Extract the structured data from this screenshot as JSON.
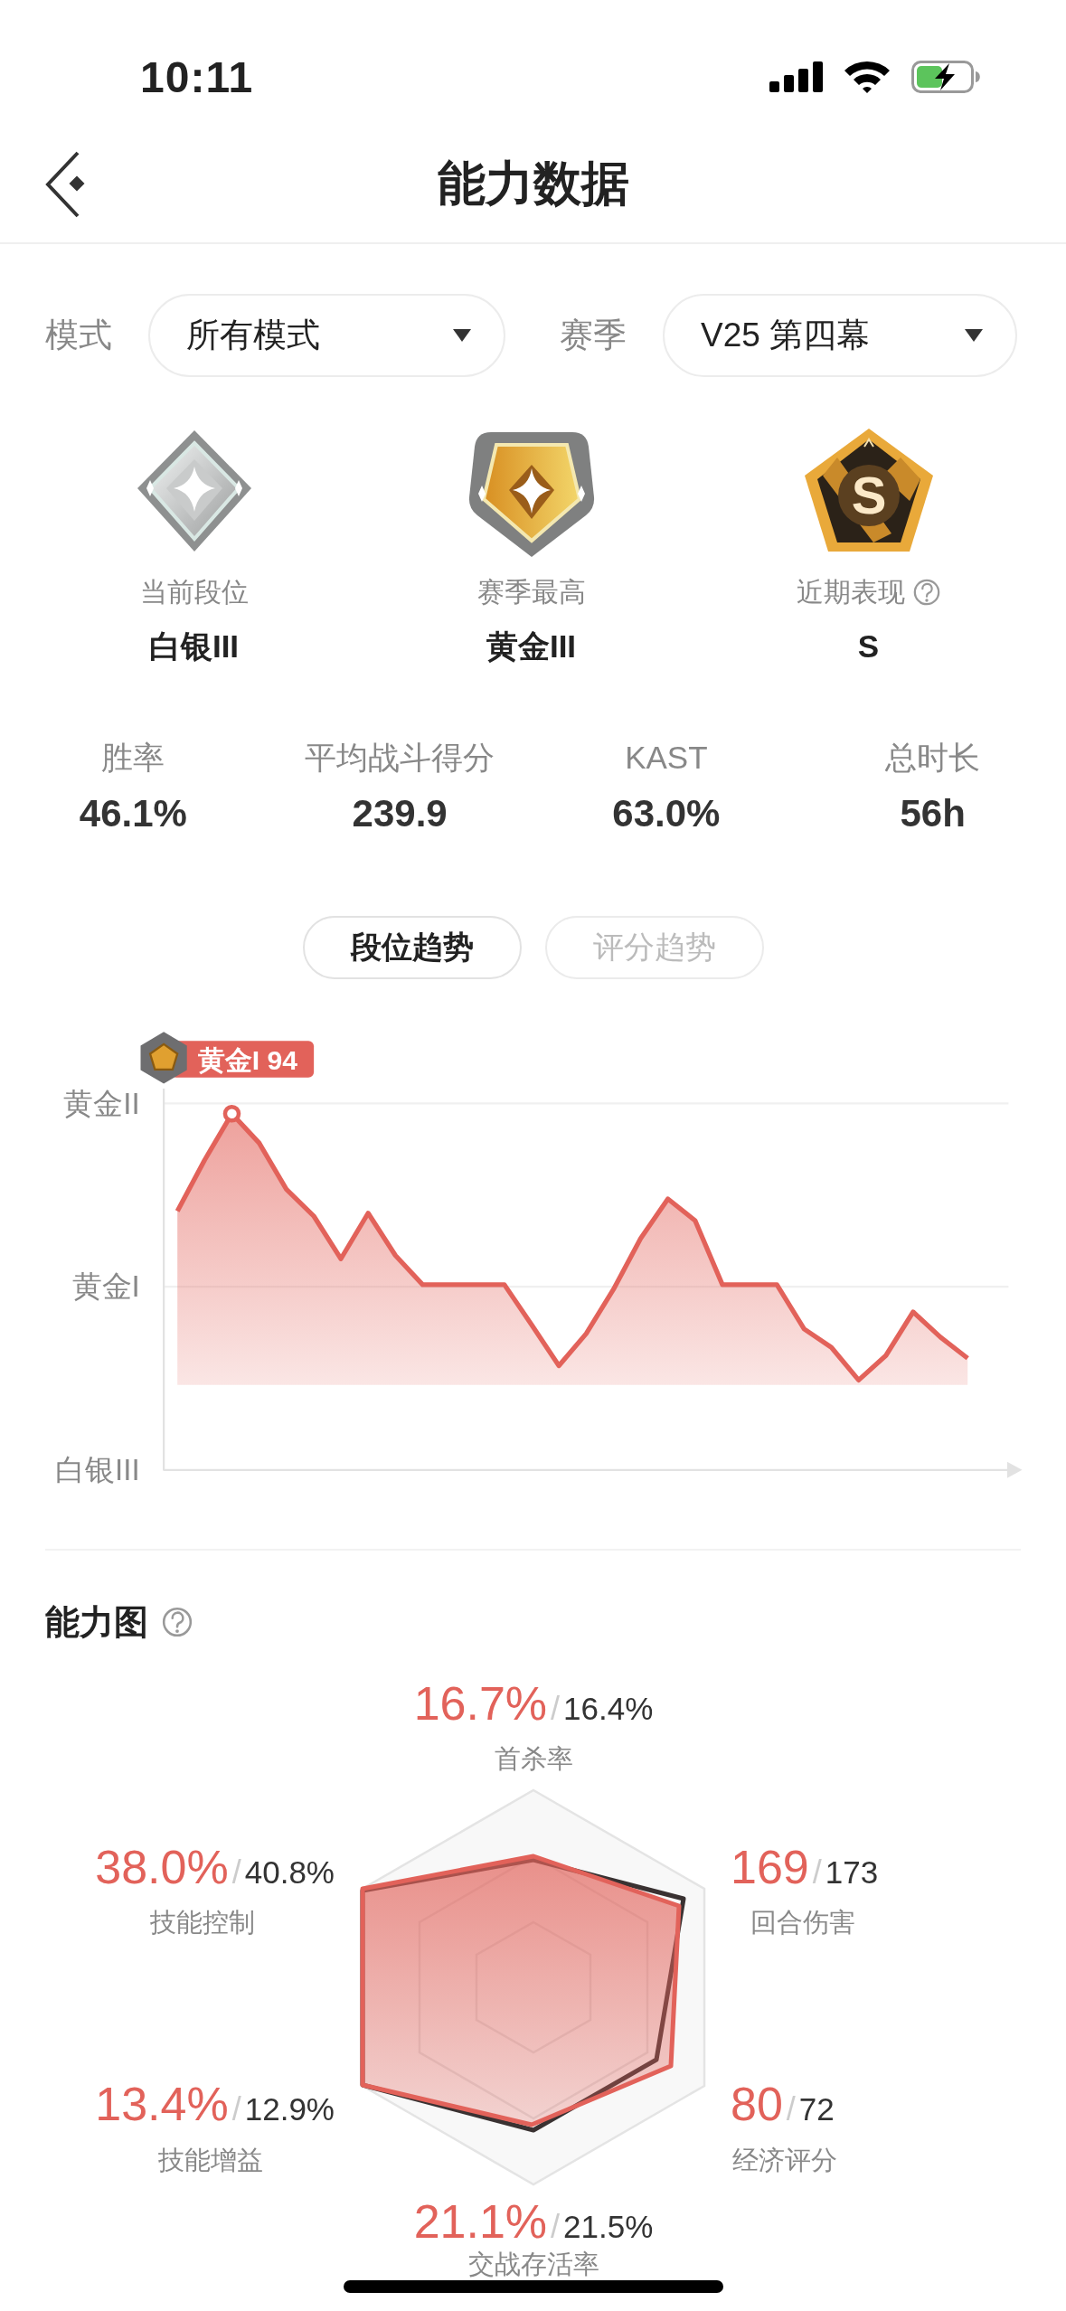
{
  "status_bar": {
    "time": "10:11"
  },
  "nav": {
    "title": "能力数据"
  },
  "filters": [
    {
      "label": "模式",
      "value": "所有模式"
    },
    {
      "label": "赛季",
      "value": "V25 第四幕"
    }
  ],
  "ranks": [
    {
      "kind": "silver",
      "caption": "当前段位",
      "value": "白银III"
    },
    {
      "kind": "gold",
      "caption": "赛季最高",
      "value": "黄金III"
    },
    {
      "kind": "grade",
      "caption": "近期表现",
      "value": "S",
      "help": true,
      "emblem_letter": "S"
    }
  ],
  "stats": [
    {
      "label": "胜率",
      "value": "46.1%"
    },
    {
      "label": "平均战斗得分",
      "value": "239.9"
    },
    {
      "label": "KAST",
      "value": "63.0%"
    },
    {
      "label": "总时长",
      "value": "56h"
    }
  ],
  "trend_tabs": [
    {
      "label": "段位趋势",
      "selected": true
    },
    {
      "label": "评分趋势",
      "selected": false
    }
  ],
  "trend_chart": {
    "y_labels": [
      "黄金II",
      "黄金I",
      "白银III"
    ],
    "peak_label": "黄金I 94"
  },
  "ability": {
    "title": "能力图",
    "help": true,
    "metrics": [
      {
        "value": "16.7%",
        "separator": "/",
        "average": "16.4%",
        "label": "首杀率"
      },
      {
        "value": "38.0%",
        "separator": "/",
        "average": "40.8%",
        "label": "技能控制"
      },
      {
        "value": "169",
        "separator": "/",
        "average": "173",
        "label": "回合伤害"
      },
      {
        "value": "13.4%",
        "separator": "/",
        "average": "12.9%",
        "label": "技能增益"
      },
      {
        "value": "80",
        "separator": "/",
        "average": "72",
        "label": "经济评分"
      },
      {
        "value": "21.1%",
        "separator": "/",
        "average": "21.5%",
        "label": "交战存活率"
      }
    ]
  }
}
